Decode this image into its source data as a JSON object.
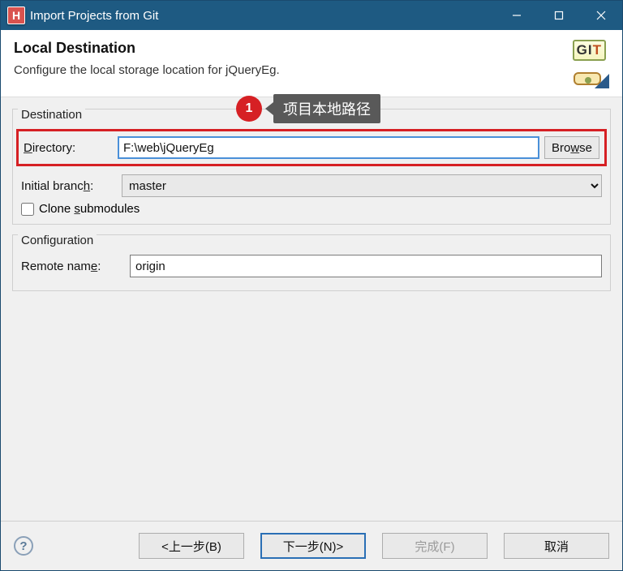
{
  "window": {
    "title": "Import Projects from Git",
    "icon_letter": "H"
  },
  "header": {
    "title": "Local Destination",
    "subtitle": "Configure the local storage location for jQueryEg.",
    "logo_text_gi": "GI",
    "logo_text_t": "T"
  },
  "annotation": {
    "number": "1",
    "text": "项目本地路径"
  },
  "destination": {
    "group_label": "Destination",
    "directory_label": "Directory:",
    "directory_value": "F:\\web\\jQueryEg",
    "browse_label": "Browse",
    "initial_branch_label": "Initial branch:",
    "initial_branch_value": "master",
    "clone_submodules_label": "Clone submodules"
  },
  "configuration": {
    "group_label": "Configuration",
    "remote_name_label": "Remote name:",
    "remote_name_value": "origin"
  },
  "footer": {
    "back": "<上一步(B)",
    "next": "下一步(N)>",
    "finish": "完成(F)",
    "cancel": "取消"
  }
}
